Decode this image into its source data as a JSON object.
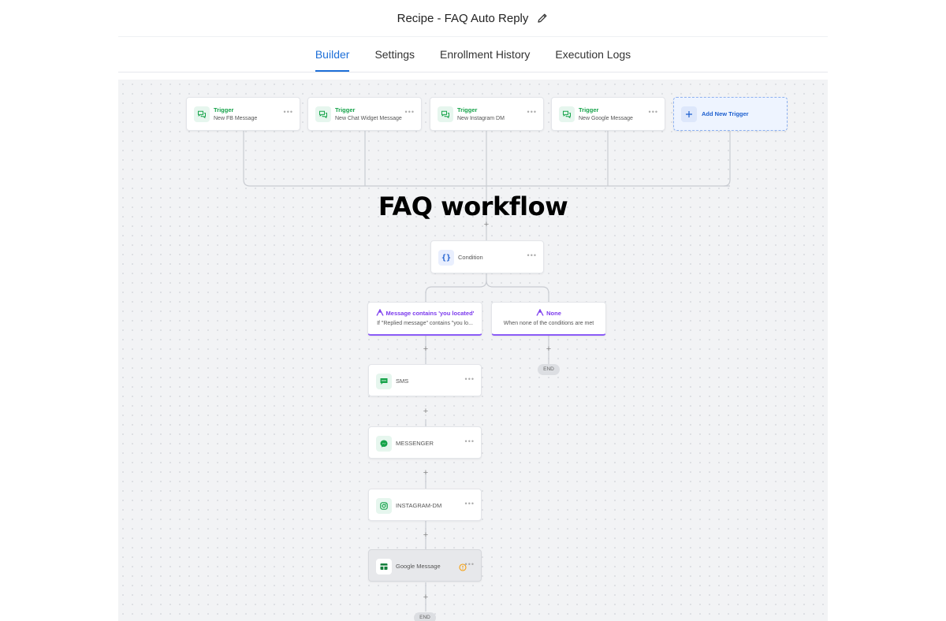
{
  "header": {
    "title": "Recipe - FAQ Auto Reply",
    "edit_icon": "pencil-icon"
  },
  "tabs": [
    {
      "label": "Builder",
      "active": true
    },
    {
      "label": "Settings"
    },
    {
      "label": "Enrollment History"
    },
    {
      "label": "Execution Logs"
    }
  ],
  "triggers": [
    {
      "label": "Trigger",
      "sub": "New FB Message",
      "icon": "chat-icon"
    },
    {
      "label": "Trigger",
      "sub": "New Chat Widget Message",
      "icon": "chat-icon"
    },
    {
      "label": "Trigger",
      "sub": "New Instagram DM",
      "icon": "chat-icon"
    },
    {
      "label": "Trigger",
      "sub": "New Google Message",
      "icon": "chat-icon"
    }
  ],
  "add_trigger": {
    "label": "Add New Trigger",
    "icon": "plus-icon"
  },
  "overlay_title": "FAQ workflow",
  "condition": {
    "label": "Condition",
    "icon": "braces-icon"
  },
  "branches": [
    {
      "title": "Message contains 'you located'",
      "sub": "If \"Replied message\" contains \"you lo...",
      "icon": "branch-icon"
    },
    {
      "title": "None",
      "sub": "When none of the conditions are met",
      "icon": "branch-icon"
    }
  ],
  "actions": [
    {
      "label": "SMS",
      "icon": "sms-icon"
    },
    {
      "label": "MESSENGER",
      "icon": "messenger-icon"
    },
    {
      "label": "INSTAGRAM-DM",
      "icon": "instagram-icon"
    },
    {
      "label": "Google Message",
      "icon": "google-message-icon",
      "warning": true
    }
  ],
  "end_label": "END",
  "colors": {
    "accent": "#1d6fd8",
    "trigger_green": "#16a34a",
    "branch_purple": "#7c3aed",
    "warning": "#f59e0b"
  }
}
